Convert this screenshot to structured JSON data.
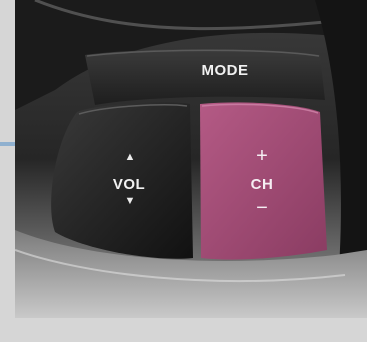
{
  "buttons": {
    "mode": {
      "label": "MODE"
    },
    "volume": {
      "label": "VOL",
      "up_symbol": "▲",
      "down_symbol": "▼"
    },
    "channel": {
      "label": "CH",
      "plus_symbol": "+",
      "minus_symbol": "−",
      "color": "#a04a73"
    }
  }
}
